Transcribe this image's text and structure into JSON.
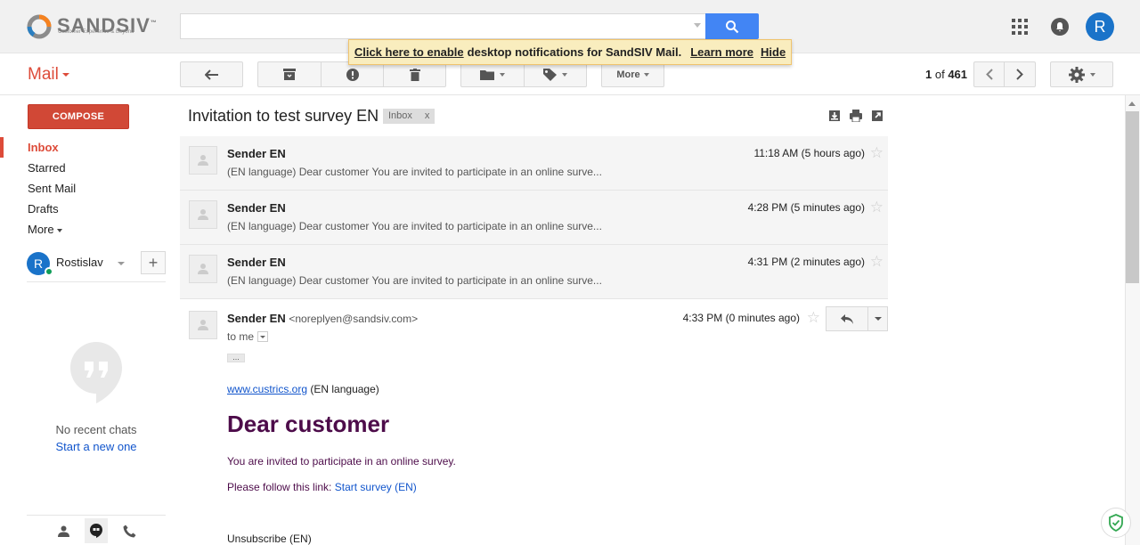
{
  "brand": {
    "name": "SANDSIV",
    "tm": "™",
    "tagline": "Customer Experience & Beyond"
  },
  "search": {
    "value": "",
    "placeholder": ""
  },
  "header": {
    "avatar_letter": "R"
  },
  "notification": {
    "enable_link": "Click here to enable",
    "message": "desktop notifications for SandSIV Mail.",
    "learn_more": "Learn more",
    "hide": "Hide"
  },
  "mail_menu": {
    "label": "Mail"
  },
  "toolbar": {
    "more_label": "More"
  },
  "pager": {
    "current": "1",
    "of_label": "of",
    "total": "461"
  },
  "compose": {
    "label": "COMPOSE"
  },
  "sidebar": {
    "items": [
      {
        "label": "Inbox"
      },
      {
        "label": "Starred"
      },
      {
        "label": "Sent Mail"
      },
      {
        "label": "Drafts"
      },
      {
        "label": "More"
      }
    ]
  },
  "chat": {
    "user_initial": "R",
    "user_name": "Rostislav",
    "add_label": "+",
    "no_recent": "No recent chats",
    "start_new": "Start a new one"
  },
  "thread": {
    "subject": "Invitation to test survey EN",
    "label_chip": "Inbox",
    "label_remove": "x",
    "messages": [
      {
        "sender": "Sender EN",
        "snippet": "(EN language) Dear customer You are invited to participate in an online surve...",
        "time": "11:18 AM (5 hours ago)"
      },
      {
        "sender": "Sender EN",
        "snippet": "(EN language) Dear customer You are invited to participate in an online surve...",
        "time": "4:28 PM (5 minutes ago)"
      },
      {
        "sender": "Sender EN",
        "snippet": "(EN language) Dear customer You are invited to participate in an online surve...",
        "time": "4:31 PM (2 minutes ago)"
      }
    ],
    "open_message": {
      "sender": "Sender EN",
      "email": "<noreplyen@sandsiv.com>",
      "to": "to me",
      "time": "4:33 PM (0 minutes ago)",
      "ellipsis": "...",
      "link": "www.custrics.org",
      "lang": "(EN language)",
      "heading": "Dear customer",
      "invited": "You are invited to participate in an online survey.",
      "follow_prefix": "Please follow this link:",
      "follow_link": "Start survey (EN)",
      "unsubscribe": "Unsubscribe (EN)"
    }
  },
  "colors": {
    "accent": "#dd4b39",
    "search_blue": "#4285f4",
    "compose": "#d14836",
    "link": "#1155cc",
    "body_text": "#4d0c4a"
  }
}
